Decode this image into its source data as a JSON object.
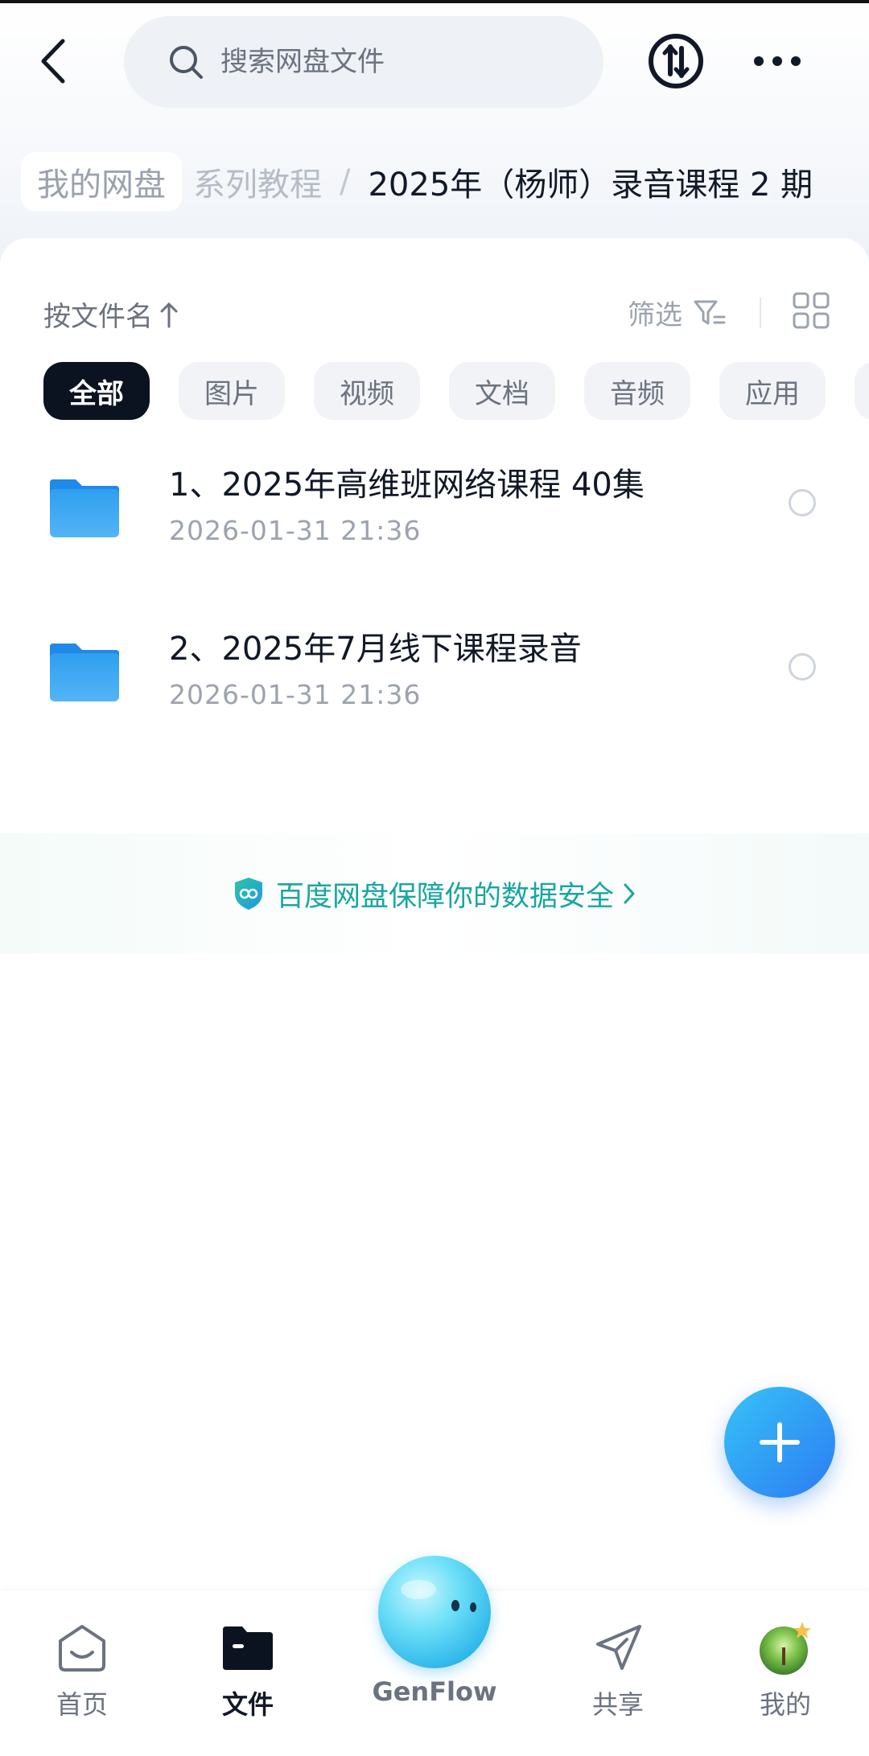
{
  "header": {
    "search_placeholder": "搜索网盘文件"
  },
  "breadcrumb": {
    "root": "我的网盘",
    "middle": "系列教程",
    "separator": "/",
    "current": "2025年（杨师）录音课程 2 期"
  },
  "toolbar": {
    "sort_label": "按文件名",
    "filter_label": "筛选"
  },
  "tabs": [
    {
      "label": "全部",
      "active": true
    },
    {
      "label": "图片",
      "active": false
    },
    {
      "label": "视频",
      "active": false
    },
    {
      "label": "文档",
      "active": false
    },
    {
      "label": "音频",
      "active": false
    },
    {
      "label": "应用",
      "active": false
    }
  ],
  "files": [
    {
      "name": "1、2025年高维班网络课程 40集",
      "date": "2026-01-31  21:36",
      "icon": "folder-icon"
    },
    {
      "name": "2、2025年7月线下课程录音",
      "date": "2026-01-31  21:36",
      "icon": "folder-icon"
    }
  ],
  "security_banner": {
    "text": "百度网盘保障你的数据安全"
  },
  "bottom_nav": [
    {
      "label": "首页",
      "icon": "home-icon",
      "active": false
    },
    {
      "label": "文件",
      "icon": "folder-icon",
      "active": true
    },
    {
      "label": "GenFlow",
      "icon": "genflow-orb-icon",
      "active": false
    },
    {
      "label": "共享",
      "icon": "send-icon",
      "active": false
    },
    {
      "label": "我的",
      "icon": "avatar",
      "active": false
    }
  ],
  "colors": {
    "accent": "#2b7cf2",
    "active_tab_bg": "#0b1220",
    "security_text": "#19a6a0",
    "folder_blue": "#2f9ff0"
  }
}
